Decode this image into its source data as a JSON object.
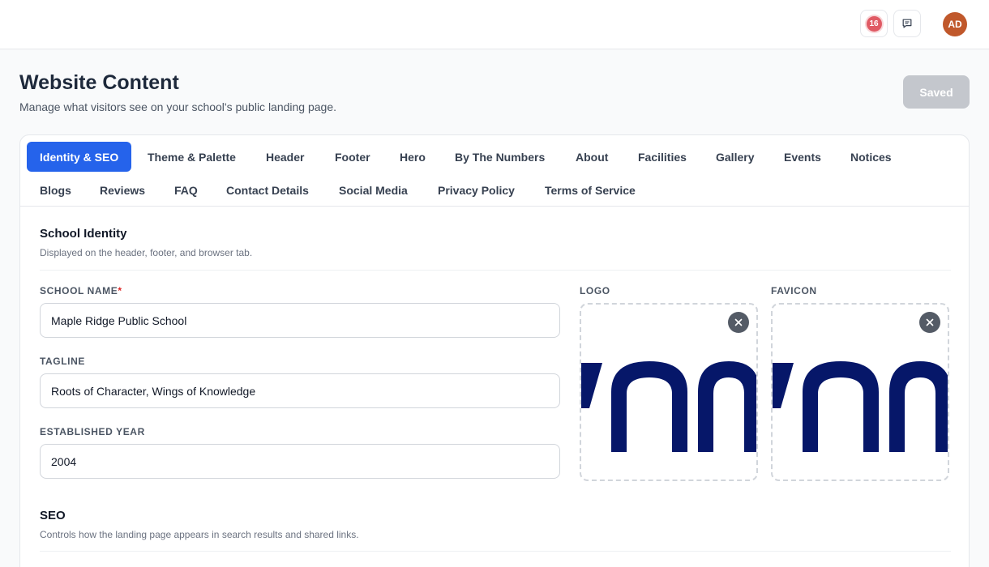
{
  "topbar": {
    "notification_count": "16",
    "avatar_initials": "AD"
  },
  "header": {
    "title": "Website Content",
    "subtitle": "Manage what visitors see on your school's public landing page.",
    "saved_label": "Saved"
  },
  "tabs": [
    {
      "label": "Identity & SEO",
      "active": true
    },
    {
      "label": "Theme & Palette"
    },
    {
      "label": "Header"
    },
    {
      "label": "Footer"
    },
    {
      "label": "Hero"
    },
    {
      "label": "By The Numbers"
    },
    {
      "label": "About"
    },
    {
      "label": "Facilities"
    },
    {
      "label": "Gallery"
    },
    {
      "label": "Events"
    },
    {
      "label": "Notices"
    },
    {
      "label": "Blogs"
    },
    {
      "label": "Reviews"
    },
    {
      "label": "FAQ"
    },
    {
      "label": "Contact Details"
    },
    {
      "label": "Social Media"
    },
    {
      "label": "Privacy Policy"
    },
    {
      "label": "Terms of Service"
    }
  ],
  "identity": {
    "title": "School Identity",
    "description": "Displayed on the header, footer, and browser tab.",
    "school_name_label": "SCHOOL NAME",
    "required_mark": "*",
    "school_name_value": "Maple Ridge Public School",
    "tagline_label": "TAGLINE",
    "tagline_value": "Roots of Character, Wings of Knowledge",
    "established_label": "ESTABLISHED YEAR",
    "established_value": "2004",
    "logo_label": "LOGO",
    "favicon_label": "FAVICON"
  },
  "seo": {
    "title": "SEO",
    "description": "Controls how the landing page appears in search results and shared links."
  },
  "colors": {
    "primary": "#2563eb",
    "logo_navy": "#061769",
    "badge": "#e05a64",
    "avatar": "#c0582b"
  }
}
